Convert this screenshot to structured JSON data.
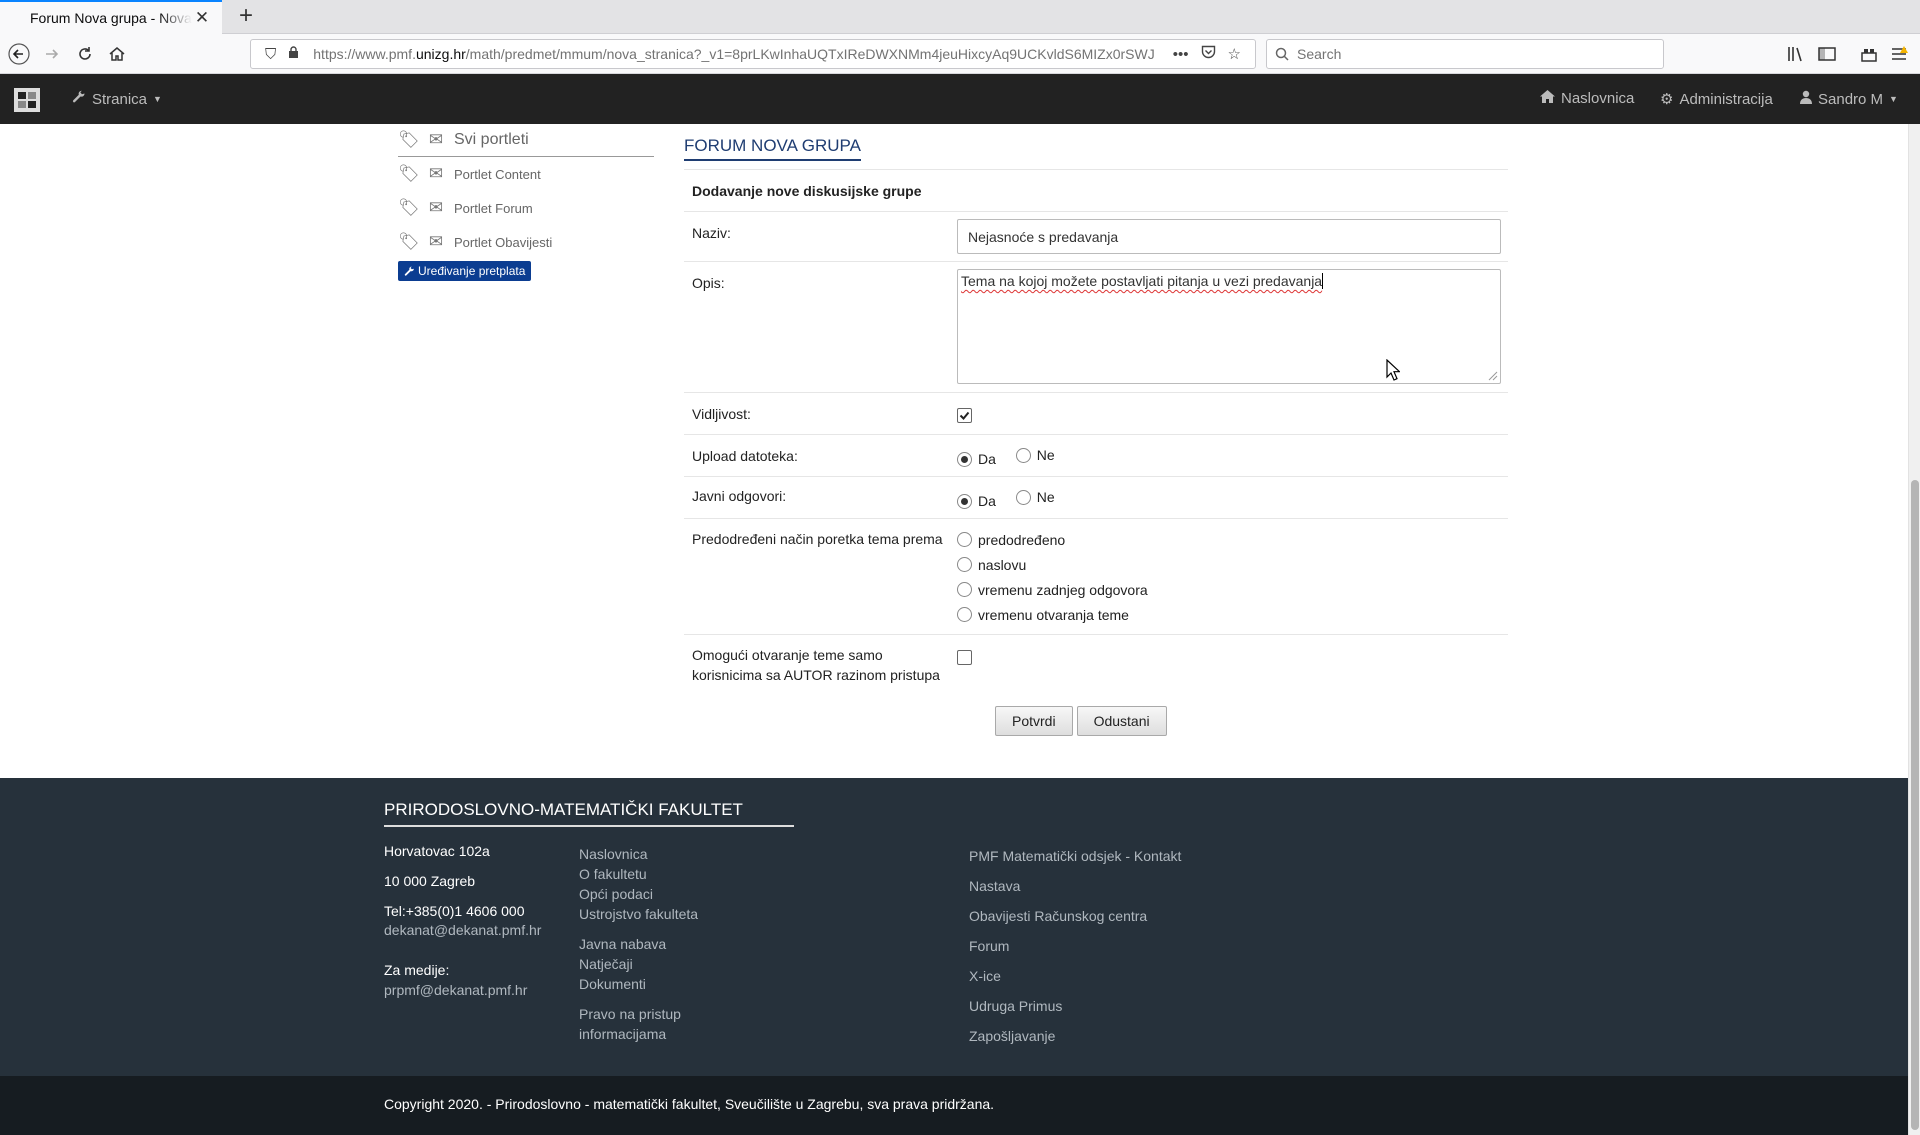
{
  "browser": {
    "tab_title": "Forum Nova grupa - Nova stranica",
    "url_prefix": "https://www.pmf.",
    "url_domain": "unizg.hr",
    "url_rest": "/math/predmet/mmum/nova_stranica?_v1=8prLKwInhaUQTxIReDWXNMm4jeuHixcyAq9UCKvldS6MIZx0rSWJ",
    "search_placeholder": "Search"
  },
  "sitenav": {
    "stranica": "Stranica",
    "naslovnica": "Naslovnica",
    "administracija": "Administracija",
    "user": "Sandro M"
  },
  "sidebar": {
    "items": [
      {
        "label": "Svi portleti"
      },
      {
        "label": "Portlet Content"
      },
      {
        "label": "Portlet Forum"
      },
      {
        "label": "Portlet Obavijesti"
      }
    ],
    "edit_button": "Uređivanje pretplata"
  },
  "form": {
    "title": "FORUM NOVA GRUPA",
    "subheading": "Dodavanje nove diskusijske grupe",
    "naziv_label": "Naziv:",
    "naziv_value": "Nejasnoće s predavanja",
    "opis_label": "Opis:",
    "opis_value": "Tema na kojoj možete postavljati pitanja u vezi predavanja",
    "vidljivost_label": "Vidljivost:",
    "vidljivost_checked": true,
    "upload_label": "Upload datoteka:",
    "javni_label": "Javni odgovori:",
    "opt_da": "Da",
    "opt_ne": "Ne",
    "poredak_label": "Predodređeni način poretka tema prema",
    "poredak_options": [
      "predodređeno",
      "naslovu",
      "vremenu zadnjeg odgovora",
      "vremenu otvaranja teme"
    ],
    "autor_label": "Omogući otvaranje teme samo korisnicima sa AUTOR razinom pristupa",
    "autor_checked": false,
    "submit": "Potvrdi",
    "cancel": "Odustani"
  },
  "footer": {
    "title": "PRIRODOSLOVNO-MATEMATIČKI FAKULTET",
    "address1": "Horvatovac 102a",
    "address2": "10 000 Zagreb",
    "tel": "Tel:+385(0)1 4606 000",
    "email": "dekanat@dekanat.pmf.hr",
    "media_label": "Za medije:",
    "media_email": "prpmf@dekanat.pmf.hr",
    "links_a": [
      "Naslovnica",
      "O fakultetu",
      "Opći podaci",
      "Ustrojstvo fakulteta"
    ],
    "links_b": [
      "Javna nabava",
      "Natječaji",
      "Dokumenti"
    ],
    "links_c": [
      "Pravo na pristup",
      "informacijama"
    ],
    "links_right": [
      "PMF Matematički odsjek - Kontakt",
      "Nastava",
      "Obavijesti Računskog centra",
      "Forum",
      "X-ice",
      "Udruga Primus",
      "Zapošljavanje"
    ],
    "copyright": "Copyright 2020. - Prirodoslovno - matematički fakultet, Sveučilište u Zagrebu, sva prava pridržana."
  },
  "colors": {
    "site_nav_bg": "#222222",
    "footer_bg": "#26313b",
    "copyright_bg": "#161c21",
    "accent": "#1f3d72",
    "edit_button_bg": "#0b3d91"
  }
}
